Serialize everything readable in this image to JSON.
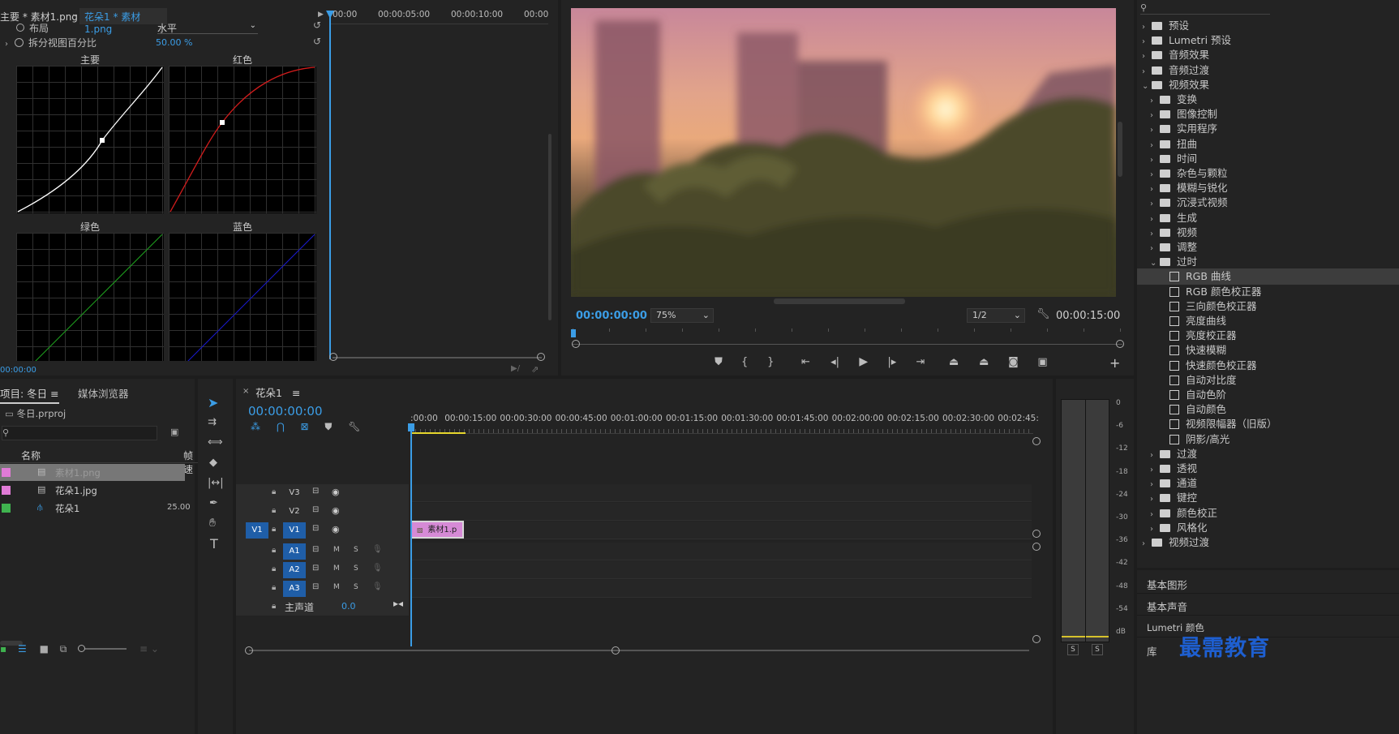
{
  "effect_controls": {
    "tab_master": "主要 * 素材1.png",
    "tab_clip": "花朵1 * 素材1.png",
    "timecodes": [
      "00:00",
      "00:00:05:00",
      "00:00:10:00",
      "00:00"
    ],
    "layout_label": "布局",
    "layout_value": "水平",
    "split_label": "拆分视图百分比",
    "split_value": "50.00 %",
    "graphs": {
      "master": "主要",
      "red": "红色",
      "green": "绿色",
      "blue": "蓝色"
    },
    "bottom_tc": "00:00:00"
  },
  "program_monitor": {
    "timecode_left": "00:00:00:00",
    "zoom": "75%",
    "resolution": "1/2",
    "timecode_right": "00:00:15:00"
  },
  "effects_panel": {
    "items": [
      {
        "label": "预设",
        "type": "folder",
        "indent": 0,
        "chev": "›"
      },
      {
        "label": "Lumetri 预设",
        "type": "folder",
        "indent": 0,
        "chev": "›"
      },
      {
        "label": "音频效果",
        "type": "folder",
        "indent": 0,
        "chev": "›"
      },
      {
        "label": "音频过渡",
        "type": "folder",
        "indent": 0,
        "chev": "›"
      },
      {
        "label": "视频效果",
        "type": "folder",
        "indent": 0,
        "chev": "⌄"
      },
      {
        "label": "变换",
        "type": "folder",
        "indent": 1,
        "chev": "›"
      },
      {
        "label": "图像控制",
        "type": "folder",
        "indent": 1,
        "chev": "›"
      },
      {
        "label": "实用程序",
        "type": "folder",
        "indent": 1,
        "chev": "›"
      },
      {
        "label": "扭曲",
        "type": "folder",
        "indent": 1,
        "chev": "›"
      },
      {
        "label": "时间",
        "type": "folder",
        "indent": 1,
        "chev": "›"
      },
      {
        "label": "杂色与颗粒",
        "type": "folder",
        "indent": 1,
        "chev": "›"
      },
      {
        "label": "模糊与锐化",
        "type": "folder",
        "indent": 1,
        "chev": "›"
      },
      {
        "label": "沉浸式视频",
        "type": "folder",
        "indent": 1,
        "chev": "›"
      },
      {
        "label": "生成",
        "type": "folder",
        "indent": 1,
        "chev": "›"
      },
      {
        "label": "视频",
        "type": "folder",
        "indent": 1,
        "chev": "›"
      },
      {
        "label": "调整",
        "type": "folder",
        "indent": 1,
        "chev": "›"
      },
      {
        "label": "过时",
        "type": "folder",
        "indent": 1,
        "chev": "⌄"
      },
      {
        "label": "RGB 曲线",
        "type": "effect",
        "indent": 2,
        "chev": ""
      },
      {
        "label": "RGB 颜色校正器",
        "type": "effect",
        "indent": 2,
        "chev": ""
      },
      {
        "label": "三向颜色校正器",
        "type": "effect",
        "indent": 2,
        "chev": ""
      },
      {
        "label": "亮度曲线",
        "type": "effect",
        "indent": 2,
        "chev": ""
      },
      {
        "label": "亮度校正器",
        "type": "effect",
        "indent": 2,
        "chev": ""
      },
      {
        "label": "快速模糊",
        "type": "effect",
        "indent": 2,
        "chev": ""
      },
      {
        "label": "快速颜色校正器",
        "type": "effect",
        "indent": 2,
        "chev": ""
      },
      {
        "label": "自动对比度",
        "type": "effect",
        "indent": 2,
        "chev": ""
      },
      {
        "label": "自动色阶",
        "type": "effect",
        "indent": 2,
        "chev": ""
      },
      {
        "label": "自动颜色",
        "type": "effect",
        "indent": 2,
        "chev": ""
      },
      {
        "label": "视频限幅器（旧版）",
        "type": "effect",
        "indent": 2,
        "chev": ""
      },
      {
        "label": "阴影/高光",
        "type": "effect",
        "indent": 2,
        "chev": ""
      },
      {
        "label": "过渡",
        "type": "folder",
        "indent": 1,
        "chev": "›"
      },
      {
        "label": "透视",
        "type": "folder",
        "indent": 1,
        "chev": "›"
      },
      {
        "label": "通道",
        "type": "folder",
        "indent": 1,
        "chev": "›"
      },
      {
        "label": "键控",
        "type": "folder",
        "indent": 1,
        "chev": "›"
      },
      {
        "label": "颜色校正",
        "type": "folder",
        "indent": 1,
        "chev": "›"
      },
      {
        "label": "风格化",
        "type": "folder",
        "indent": 1,
        "chev": "›"
      },
      {
        "label": "视频过渡",
        "type": "folder",
        "indent": 0,
        "chev": "›"
      }
    ],
    "bottom_tabs": [
      "基本图形",
      "基本声音",
      "Lumetri 颜色",
      "库"
    ],
    "watermark": "最需教育"
  },
  "project_panel": {
    "tab_project": "项目: 冬日",
    "tab_media": "媒体浏览器",
    "file": "冬日.prproj",
    "col_name": "名称",
    "col_rate": "帧速",
    "rows": [
      {
        "name": "素材1.png",
        "color": "#e07bd6",
        "rate": ""
      },
      {
        "name": "花朵1.jpg",
        "color": "#e07bd6",
        "rate": ""
      },
      {
        "name": "花朵1",
        "color": "#3fb34f",
        "rate": "25.00"
      }
    ]
  },
  "timeline": {
    "tab": "花朵1",
    "timecode": "00:00:00:00",
    "ruler": [
      ":00:00",
      "00:00:15:00",
      "00:00:30:00",
      "00:00:45:00",
      "00:01:00:00",
      "00:01:15:00",
      "00:01:30:00",
      "00:01:45:00",
      "00:02:00:00",
      "00:02:15:00",
      "00:02:30:00",
      "00:02:45:"
    ],
    "video_tracks": [
      "V3",
      "V2",
      "V1"
    ],
    "audio_tracks": [
      "A1",
      "A2",
      "A3"
    ],
    "source_patch": "V1",
    "master_label": "主声道",
    "master_value": "0.0",
    "clip_label": "素材1.p",
    "m_label": "M",
    "s_label": "S"
  },
  "meter": {
    "scale": [
      "0",
      "-6",
      "-12",
      "-18",
      "-24",
      "-30",
      "-36",
      "-42",
      "-48",
      "-54",
      "dB"
    ],
    "solo": [
      "S",
      "S"
    ]
  }
}
